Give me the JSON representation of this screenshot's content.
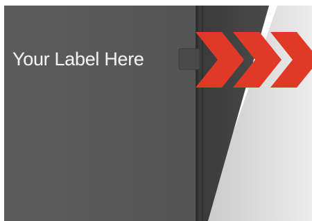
{
  "panel": {
    "label": "Your Label Here"
  },
  "colors": {
    "panel_dark": "#5a5a5a",
    "panel_edge": "#3b3b3b",
    "chevron_red": "#e03a27",
    "background": "#ffffff",
    "accent_gray": "#d9d9d9"
  },
  "chevrons": {
    "count": 3,
    "icon": "chevron-right-icon"
  }
}
